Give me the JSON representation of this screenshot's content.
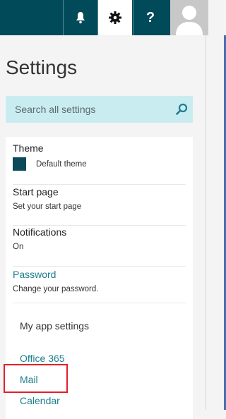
{
  "topbar": {
    "bell": "bell-icon",
    "gear": "gear-icon",
    "help": "?",
    "avatar": "user-avatar-icon",
    "accent": "#004a5a"
  },
  "settings": {
    "title": "Settings",
    "search_placeholder": "Search all settings"
  },
  "items": {
    "theme": {
      "label": "Theme",
      "value": "Default theme",
      "swatch_color": "#0b4a58"
    },
    "start_page": {
      "label": "Start page",
      "desc": "Set your start page"
    },
    "notifications": {
      "label": "Notifications",
      "desc": "On"
    },
    "password": {
      "label": "Password",
      "desc": "Change your password."
    }
  },
  "app_settings": {
    "heading": "My app settings",
    "links": [
      "Office 365",
      "Mail",
      "Calendar"
    ]
  },
  "colors": {
    "link": "#1b7f8c",
    "search_bg": "#c9ecf0",
    "highlight": "#e0202a"
  }
}
